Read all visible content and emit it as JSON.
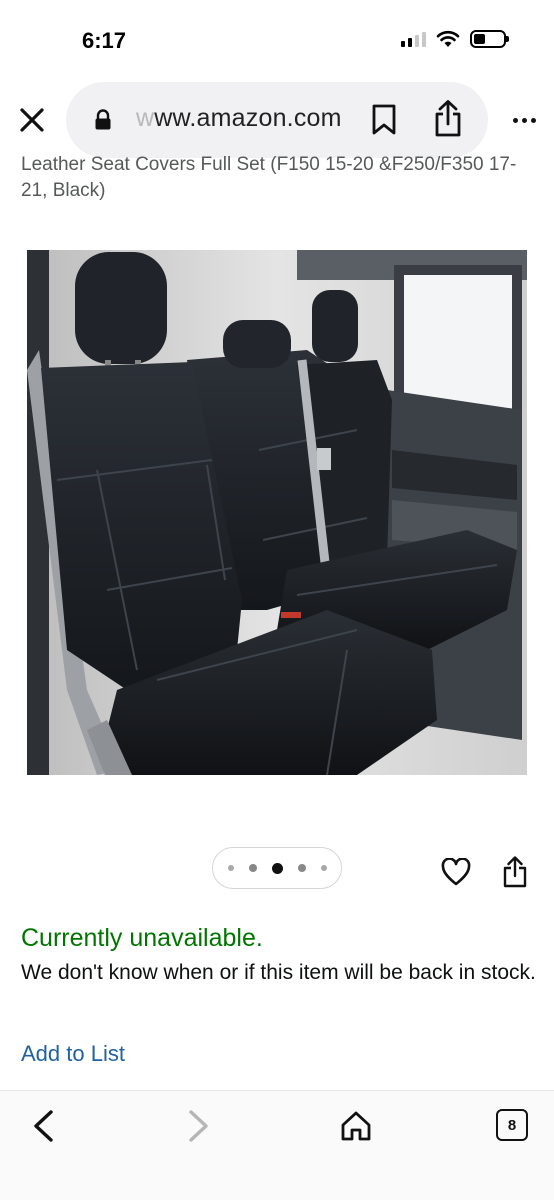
{
  "status_bar": {
    "time": "6:17"
  },
  "browser": {
    "url_prefix_faded": "w",
    "url_display": "ww.amazon.com",
    "icons": [
      "close-icon",
      "lock-icon",
      "bookmark-icon",
      "share-icon",
      "more-icon"
    ]
  },
  "product": {
    "title_partial": "Leather Seat Covers Full Set (F150 15-20 &F250/F350 17-21, Black)",
    "image_alt": "Black leather rear bench seat covers installed in a truck",
    "carousel": {
      "total": 5,
      "active_index": 2
    },
    "availability": "Currently unavailable.",
    "availability_note": "We don't know when or if this item will be back in stock.",
    "add_to_list": "Add to List"
  },
  "toolbar": {
    "tab_count": "8"
  },
  "colors": {
    "availability_green": "#007600",
    "link_blue": "#2162a1",
    "url_bar_bg": "#f1f1f3"
  }
}
